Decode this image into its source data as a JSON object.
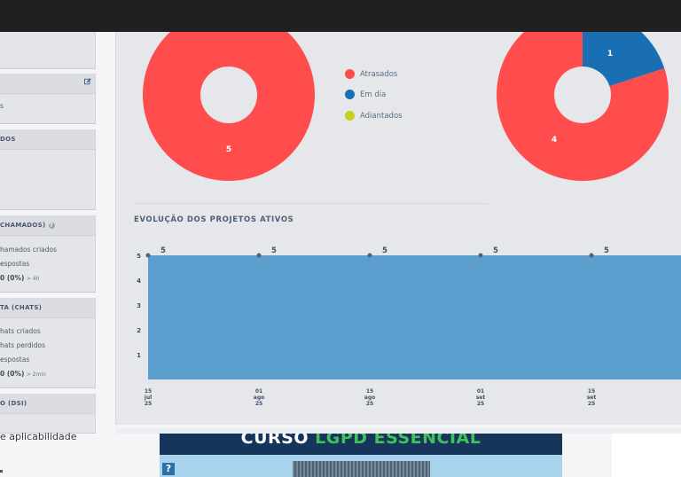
{
  "left_cards": {
    "card2_line": "s",
    "card3_header": "DOS",
    "card4_header": "CHAMADOS)",
    "card4_lines": [
      "hamados criados",
      "espostas"
    ],
    "card4_value": "0 (0%)",
    "card4_value_note": "> 4h",
    "card5_header": "TA (CHATS)",
    "card5_lines": [
      "hats criados",
      "hats perdidos",
      "espostas"
    ],
    "card5_value": "0 (0%)",
    "card5_value_note": "> 2min",
    "card6_header": "O (DSI)"
  },
  "pie_left": {
    "label": "5",
    "color": "#ff4d4d"
  },
  "pie_right": {
    "label_big": "4",
    "label_small": "1",
    "colors": [
      "#ff4d4d",
      "#1a6fb3"
    ]
  },
  "legend": [
    {
      "label": "Atrasados",
      "color": "#ff4d4d"
    },
    {
      "label": "Em dia",
      "color": "#1a6fb3"
    },
    {
      "label": "Adiantados",
      "color": "#c8d21e"
    }
  ],
  "section_title": "EVOLUÇÃO DOS PROJETOS ATIVOS",
  "chart_data": {
    "type": "area",
    "title": "EVOLUÇÃO DOS PROJETOS ATIVOS",
    "x": [
      "15 jul 25",
      "01 ago 25",
      "15 ago 25",
      "01 set 25",
      "15 set 25"
    ],
    "x_ticks": [
      [
        "15",
        "jul",
        "25"
      ],
      [
        "01",
        "ago",
        "25"
      ],
      [
        "15",
        "ago",
        "25"
      ],
      [
        "01",
        "set",
        "25"
      ],
      [
        "15",
        "set",
        "25"
      ]
    ],
    "series": [
      {
        "values": [
          5,
          5,
          5,
          5,
          5
        ],
        "color": "#5c9ecd"
      }
    ],
    "data_labels": [
      "5",
      "5",
      "5",
      "5",
      "5"
    ],
    "y_ticks": [
      1,
      2,
      3,
      4,
      5
    ],
    "ylim": [
      0,
      5
    ]
  },
  "bottom": {
    "left_text": "e aplicabilidade",
    "banner_word1": "CURSO",
    "banner_word2": "LGPD ESSENCIAL",
    "banner_help": "?"
  }
}
